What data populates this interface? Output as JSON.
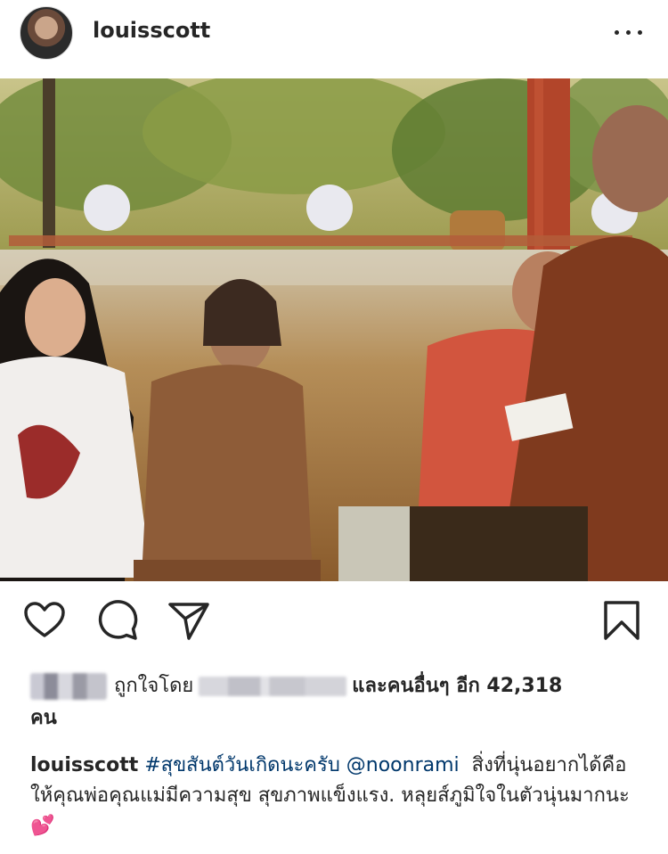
{
  "post": {
    "username": "louisscott",
    "photo_description": "",
    "likes": {
      "liked_by_prefix": "ถูกใจโดย",
      "and_others": "และคนอื่นๆ อีก 42,318",
      "unit": "คน"
    },
    "caption": {
      "username": "louisscott",
      "hashtag": "#สุขสันต์วันเกิดนะครับ",
      "mention": "@noonrami",
      "text": "สิ่งที่นุ่นอยากได้คือให้คุณพ่อคุณแม่มีความสุข สุขภาพแข็งแรง. หลุยส์ภูมิใจในตัวนุ่นมากนะ",
      "emoji": "💕"
    }
  },
  "icons": {
    "more": "more-options-icon",
    "like": "heart-icon",
    "comment": "comment-icon",
    "share": "send-icon",
    "save": "bookmark-icon"
  },
  "colors": {
    "text": "#262626",
    "link": "#00376b",
    "background": "#ffffff"
  }
}
